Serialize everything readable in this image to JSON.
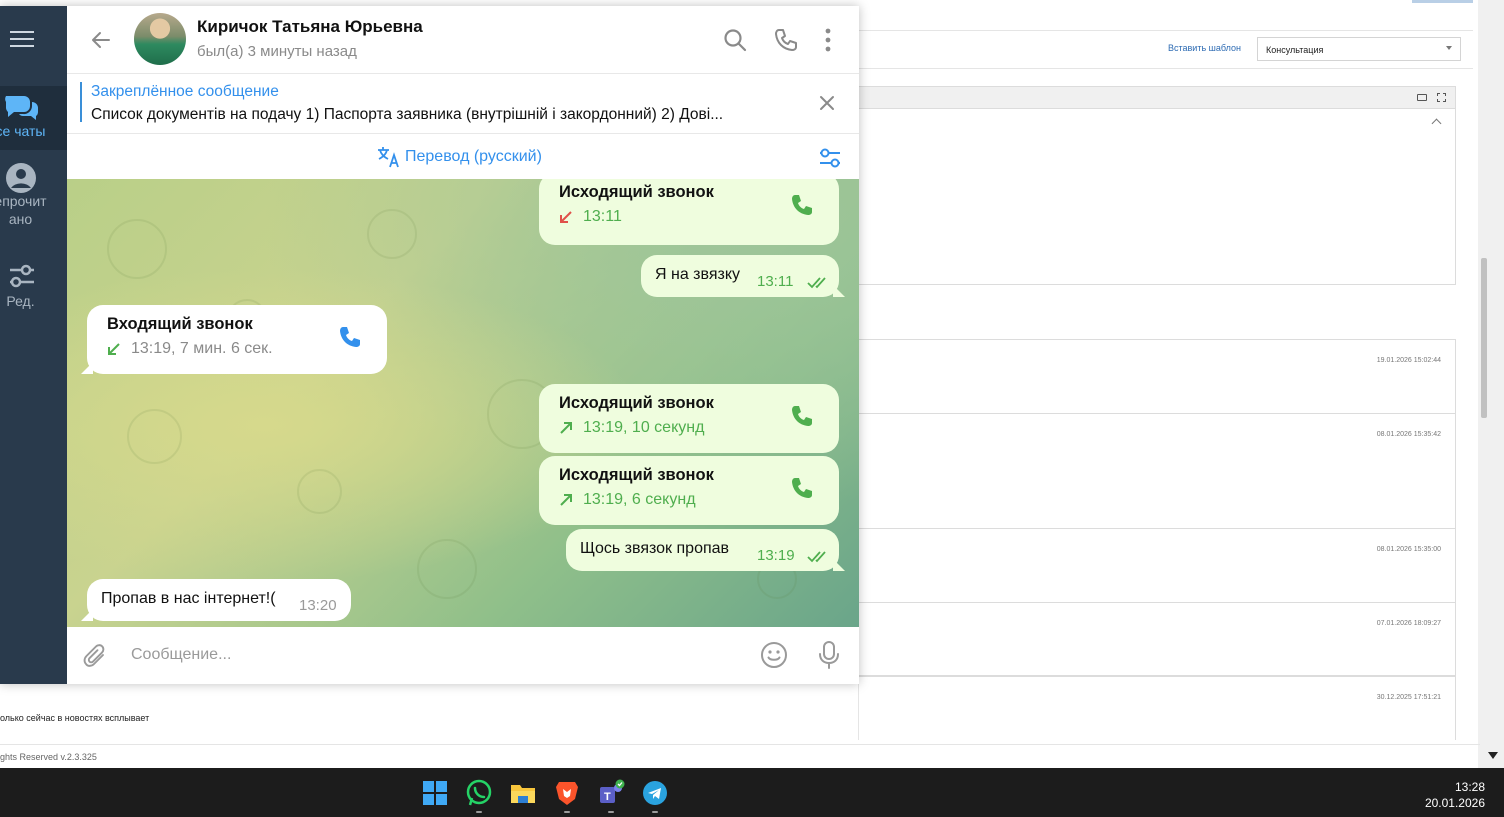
{
  "background_app": {
    "insert_template_label": "Вставить шаблон",
    "template_select_value": "Консультация",
    "history_dates": [
      "19.01.2026 15:02:44",
      "08.01.2026 15:35:42",
      "08.01.2026 15:35:00",
      "07.01.2026 18:09:27",
      "30.12.2025 17:51:21"
    ],
    "news_text": "олько сейчас в новостях всплывает",
    "footer_text": "ghts Reserved v.2.3.325"
  },
  "telegram": {
    "sidebar": {
      "items": [
        {
          "label": "се чаты",
          "icon": "chats-icon",
          "active": true
        },
        {
          "label": "епрочит\nано",
          "icon": "unread-icon",
          "active": false
        },
        {
          "label": "Ред.",
          "icon": "edit-folders-icon",
          "active": false
        }
      ]
    },
    "header": {
      "name": "Киричок Татьяна Юрьевна",
      "status": "был(а) 3 минуты назад"
    },
    "pinned": {
      "title": "Закреплённое сообщение",
      "text": "Список документів на подачу  1) Паспорта заявника (внутрішній і закордонний) 2) Дові..."
    },
    "translate": {
      "label": "Перевод (русский)"
    },
    "messages": [
      {
        "type": "call",
        "direction": "out",
        "title": "Исходящий звонок",
        "meta": "13:11",
        "missed": true
      },
      {
        "type": "text",
        "direction": "out",
        "text": "Я на звязку",
        "time": "13:11"
      },
      {
        "type": "call",
        "direction": "in",
        "title": "Входящий звонок",
        "meta": "13:19, 7 мин. 6 сек."
      },
      {
        "type": "call",
        "direction": "out",
        "title": "Исходящий звонок",
        "meta": "13:19, 10 секунд"
      },
      {
        "type": "call",
        "direction": "out",
        "title": "Исходящий звонок",
        "meta": "13:19, 6 секунд"
      },
      {
        "type": "text",
        "direction": "out",
        "text": "Щось звязок пропав",
        "time": "13:19"
      },
      {
        "type": "text",
        "direction": "in",
        "text": "Пропав в нас інтернет!(",
        "time": "13:20"
      }
    ],
    "composer": {
      "placeholder": "Сообщение..."
    },
    "colors": {
      "accent": "#3390ec",
      "sidebar_bg": "#293a4c",
      "outgoing_bubble": "#effdde",
      "call_green": "#4fae4e",
      "missed_red": "#e0514a"
    }
  },
  "taskbar": {
    "apps": [
      "windows-start-icon",
      "whatsapp-icon",
      "file-explorer-icon",
      "brave-icon",
      "teams-icon",
      "telegram-icon"
    ],
    "time": "13:28",
    "date": "20.01.2026"
  }
}
